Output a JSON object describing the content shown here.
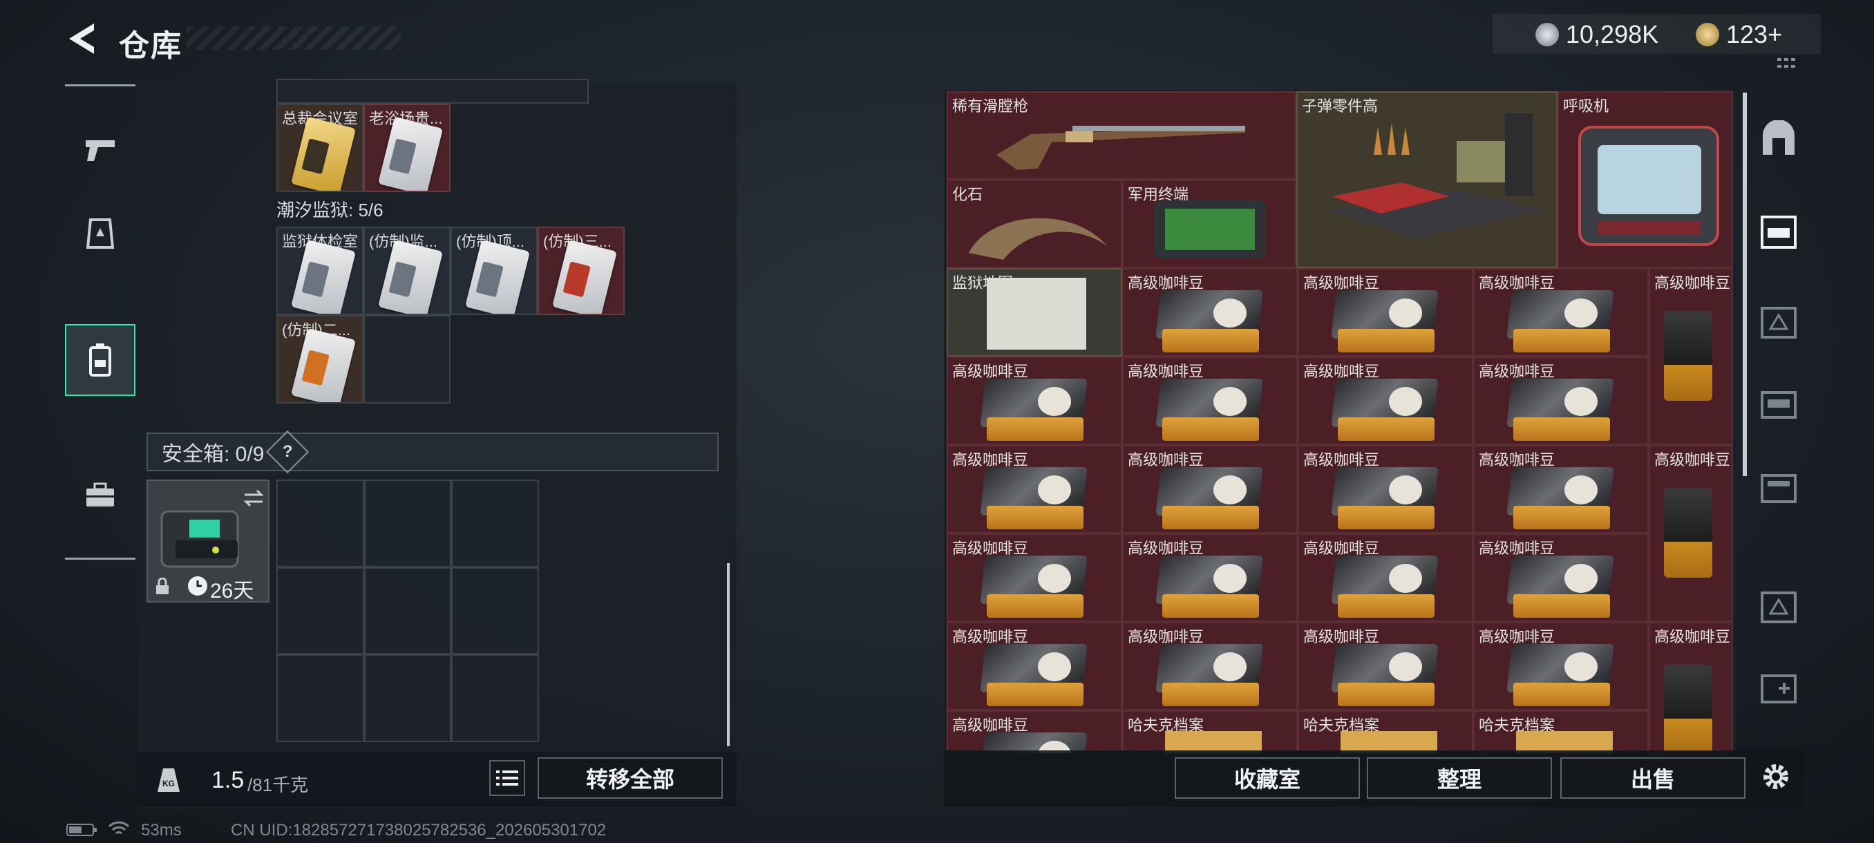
{
  "header": {
    "title": "仓库",
    "currency": [
      {
        "icon": "silver-coin-icon",
        "value": "10,298K"
      },
      {
        "icon": "gold-coin-icon",
        "value": "123+"
      }
    ]
  },
  "left": {
    "row1": [
      {
        "label": "总裁会议室",
        "style": "brown"
      },
      {
        "label": "老浴场贵...",
        "style": "red"
      }
    ],
    "section_title": "潮汐监狱: 5/6",
    "row2": [
      {
        "label": "监狱体检室",
        "style": "dark"
      },
      {
        "label": "(仿制)监...",
        "style": "dark"
      },
      {
        "label": "(仿制)顶...",
        "style": "dark"
      },
      {
        "label": "(仿制)三...",
        "style": "red"
      }
    ],
    "row3": [
      {
        "label": "(仿制)二...",
        "style": "brown"
      }
    ],
    "safe_box": {
      "label": "安全箱: 0/9",
      "help": "?",
      "timer": "26天"
    },
    "weight": {
      "current": "1.5",
      "max": "/81千克"
    },
    "transfer_all": "转移全部"
  },
  "right": {
    "items": {
      "shotgun": "稀有滑膛枪",
      "bullet_parts": "子弹零件高",
      "respirator": "呼吸机",
      "fossil": "化石",
      "terminal": "军用终端",
      "prison_map": "监狱地图",
      "coffee": "高级咖啡豆",
      "archive": "哈夫克档案"
    },
    "buttons": {
      "collection": "收藏室",
      "sort": "整理",
      "sell": "出售"
    }
  },
  "status": {
    "ping": "53ms",
    "uid": "CN UID:18285727173802578253​6_202605301702"
  }
}
